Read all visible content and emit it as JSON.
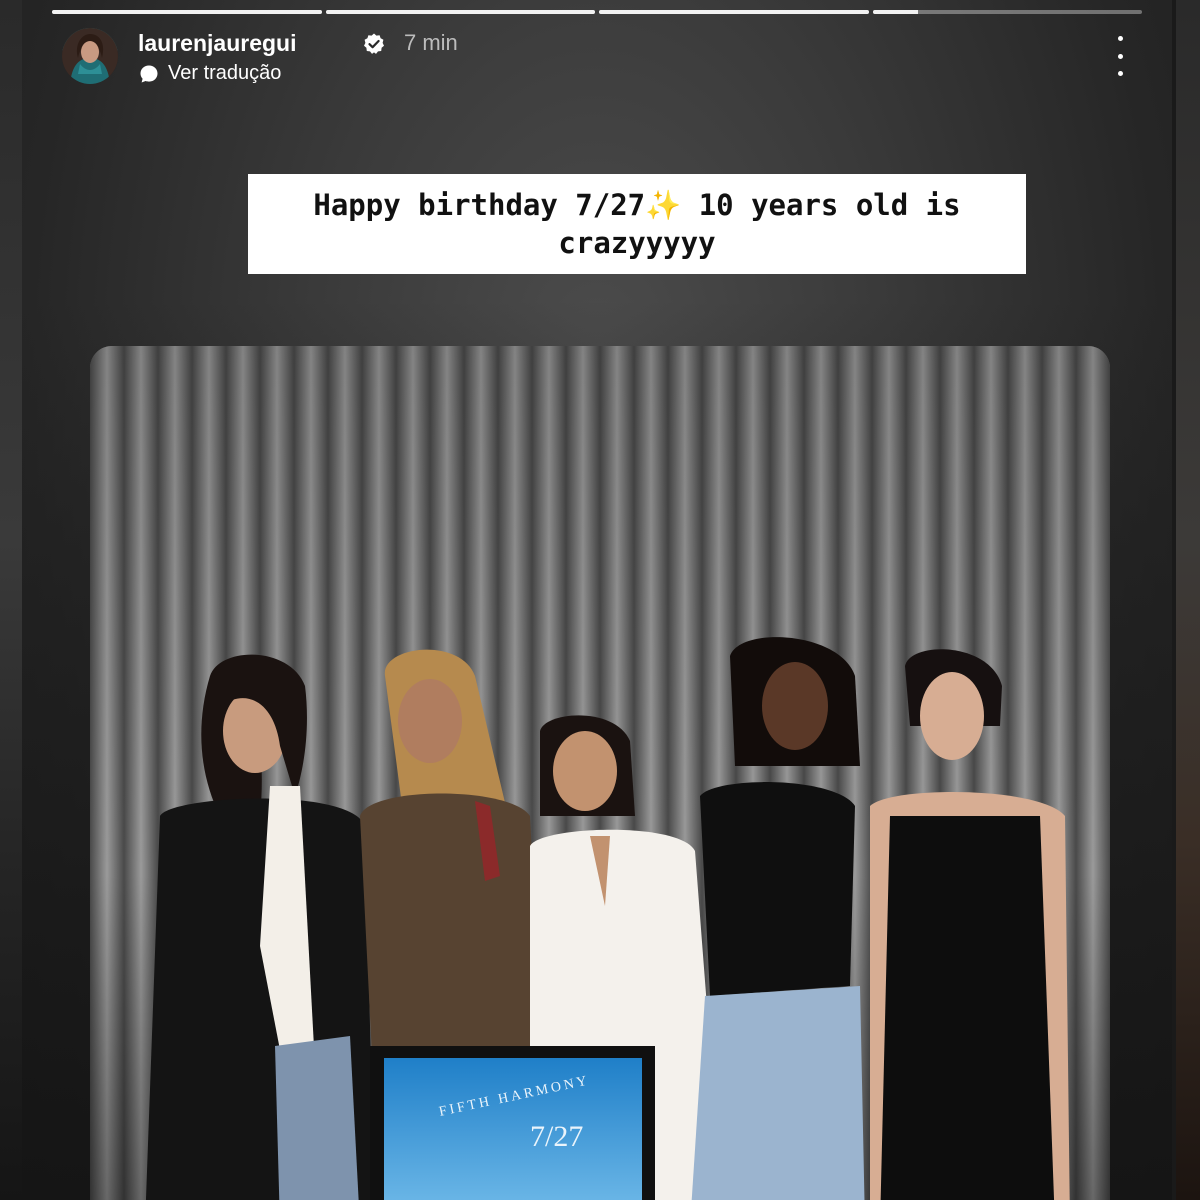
{
  "story": {
    "progress": [
      1,
      1,
      1,
      0.17
    ],
    "user": {
      "username": "laurenjauregui",
      "verified": true,
      "timestamp": "7 min"
    },
    "translate_label": "Ver tradução",
    "caption": {
      "line1": "Happy birthday 7/27",
      "emoji": "✨",
      "line1_end": " 10 years old is",
      "line2": "crazyyyyy"
    },
    "photo": {
      "album_brand": "FIFTH HARMONY",
      "album_title": "7/27"
    },
    "icons": {
      "verified": "verified-badge-icon",
      "translate": "translate-bubble-icon",
      "more": "more-options-icon"
    },
    "colors": {
      "verified_badge": "#ffffff",
      "caption_bg": "#ffffff",
      "caption_text": "#111111",
      "progress_fill": "#f2f2f2",
      "progress_track": "#8c8c8c"
    }
  }
}
